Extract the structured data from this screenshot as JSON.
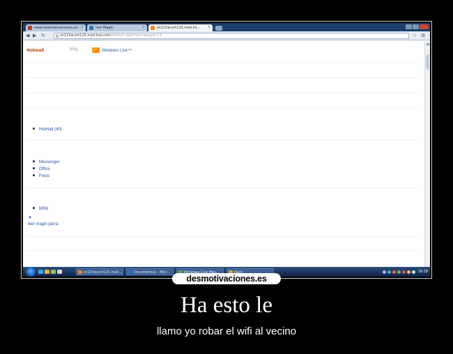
{
  "browser": {
    "tabs": [
      {
        "label": "www.desmotivaciones.es",
        "color": "#c0392b"
      },
      {
        "label": "Iker Magin",
        "color": "#2d6fb8"
      },
      {
        "label": "sn115w.snt115.mail.liv...",
        "color": "#f08c1a"
      }
    ],
    "url": "sn115w.snt115.mail.live.com",
    "url_path": "/default.aspx?wa=wsignin1.0"
  },
  "page": {
    "logo_text": "Hotmail",
    "secondary_logo": "bing",
    "windows_live": "Windows Live™",
    "links_group1": [
      "Hotmail (40)"
    ],
    "links_group2": [
      "Messenger",
      "Office",
      "Fotos"
    ],
    "links_group3": [
      "MSN"
    ],
    "profile_arrow": "▼",
    "profile_name": "iker magin parra"
  },
  "taskbar": {
    "items": [
      {
        "label": "sn115w.snt115.mail...",
        "color": "#f08c1a"
      },
      {
        "label": "Documento1 - Micr...",
        "color": "#2d6fb8"
      },
      {
        "label": "Windows Live Mes...",
        "color": "#4fae4a"
      },
      {
        "label": "Paint",
        "color": "#d9a24a"
      }
    ],
    "clock": "19:19"
  },
  "site_logo": "desmotivaciones.es",
  "headline": "Ha esto le",
  "subtitle": "llamo yo robar el wifi al vecino"
}
